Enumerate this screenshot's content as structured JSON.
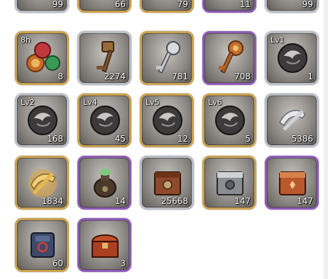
{
  "inventory": {
    "row0": [
      {
        "count": "99",
        "frame": "silver",
        "icon": "item-icon"
      },
      {
        "count": "66",
        "frame": "gold",
        "icon": "item-icon"
      },
      {
        "count": "79",
        "frame": "gold",
        "icon": "item-icon"
      },
      {
        "count": "11",
        "frame": "purple",
        "icon": "item-icon"
      },
      {
        "count": "99",
        "frame": "silver",
        "icon": "item-icon"
      }
    ],
    "row1": [
      {
        "tag": "8h",
        "count": "8",
        "frame": "gold",
        "icon": "gem-cluster-icon"
      },
      {
        "count": "2274",
        "frame": "silver",
        "icon": "bronze-key-icon"
      },
      {
        "count": "781",
        "frame": "gold",
        "icon": "silver-key-icon"
      },
      {
        "count": "708",
        "frame": "purple",
        "icon": "ornate-key-icon"
      },
      {
        "tag": "Lv1",
        "count": "1",
        "frame": "silver",
        "icon": "dark-orb-icon"
      }
    ],
    "row2": [
      {
        "tag": "Lv2",
        "count": "168",
        "frame": "silver",
        "icon": "dark-orb-icon"
      },
      {
        "tag": "Lv4",
        "count": "45",
        "frame": "gold",
        "icon": "dark-orb-icon"
      },
      {
        "tag": "Lv5",
        "count": "12",
        "frame": "gold",
        "icon": "dark-orb-icon"
      },
      {
        "tag": "Lv6",
        "count": "5",
        "frame": "gold",
        "icon": "dark-orb-icon"
      },
      {
        "count": "5386",
        "frame": "silver",
        "icon": "silver-scroll-icon"
      }
    ],
    "row3": [
      {
        "count": "1834",
        "frame": "gold",
        "icon": "gold-scroll-icon"
      },
      {
        "count": "14",
        "frame": "purple",
        "icon": "potion-pot-icon"
      },
      {
        "count": "25668",
        "frame": "silver",
        "icon": "bronze-chest-icon"
      },
      {
        "count": "147",
        "frame": "gold",
        "icon": "silver-chest-icon"
      },
      {
        "count": "147",
        "frame": "purple",
        "icon": "red-chest-icon"
      }
    ],
    "row4": [
      {
        "count": "60",
        "frame": "gold",
        "icon": "blue-box-icon"
      },
      {
        "count": "3",
        "frame": "purple",
        "icon": "treasure-chest-icon"
      }
    ]
  },
  "colors": {
    "gold_frame": "#caa14e",
    "silver_frame": "#b9bcc4",
    "purple_frame": "#8e5bb8"
  }
}
